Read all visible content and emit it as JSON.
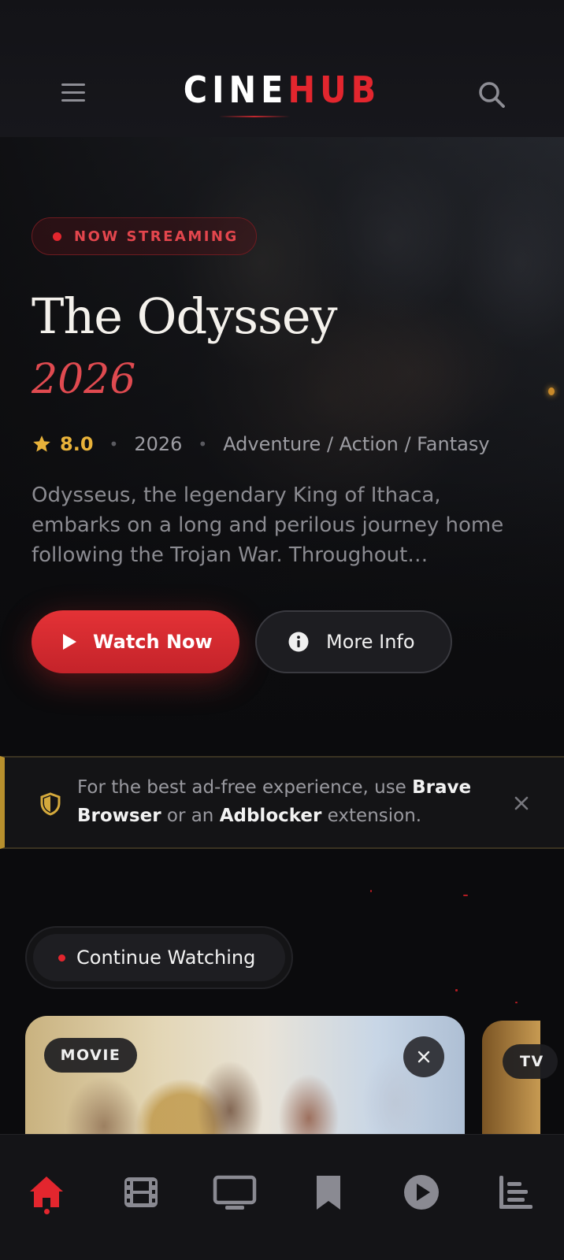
{
  "header": {
    "logo_part1": "CINE",
    "logo_part2": "HUB"
  },
  "hero": {
    "badge": "NOW STREAMING",
    "title": "The Odyssey",
    "year_display": "2026",
    "rating": "8.0",
    "year": "2026",
    "genres": "Adventure / Action / Fantasy",
    "description": "Odysseus, the legendary King of Ithaca, embarks on a long and perilous journey home following the Trojan War. Throughout…",
    "watch_label": "Watch Now",
    "info_label": "More Info"
  },
  "notice": {
    "text_1": "For the best ad-free experience, use ",
    "bold_1": "Brave Browser",
    "text_2": " or an ",
    "bold_2": "Adblocker",
    "text_3": " extension."
  },
  "continue_watching": {
    "label": "Continue Watching",
    "cards": [
      {
        "type": "MOVIE"
      },
      {
        "type": "TV"
      }
    ]
  },
  "bottom_nav": {
    "items": [
      {
        "icon": "home-icon",
        "active": true
      },
      {
        "icon": "film-icon",
        "active": false
      },
      {
        "icon": "tv-icon",
        "active": false
      },
      {
        "icon": "bookmark-icon",
        "active": false
      },
      {
        "icon": "play-circle-icon",
        "active": false
      },
      {
        "icon": "leaderboard-icon",
        "active": false
      }
    ]
  },
  "colors": {
    "accent": "#e3262e",
    "gold": "#e8b23a",
    "background": "#0b0b0d"
  }
}
